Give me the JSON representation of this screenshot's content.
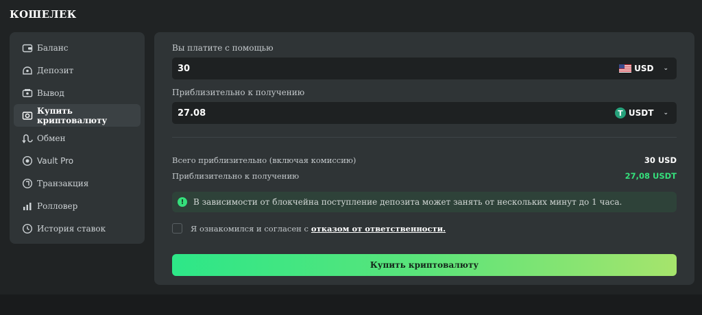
{
  "page": {
    "title": "КОШЕЛЕК"
  },
  "sidebar": {
    "items": [
      {
        "label": "Баланс",
        "icon": "wallet-icon"
      },
      {
        "label": "Депозит",
        "icon": "deposit-icon"
      },
      {
        "label": "Вывод",
        "icon": "withdraw-icon"
      },
      {
        "label": "Купить криптовалюту",
        "icon": "buy-crypto-icon",
        "active": true
      },
      {
        "label": "Обмен",
        "icon": "exchange-icon"
      },
      {
        "label": "Vault Pro",
        "icon": "vault-icon"
      },
      {
        "label": "Транзакция",
        "icon": "transaction-icon"
      },
      {
        "label": "Ролловер",
        "icon": "rollover-icon"
      },
      {
        "label": "История ставок",
        "icon": "clock-icon"
      }
    ]
  },
  "form": {
    "pay_label": "Вы платите с помощью",
    "pay_value": "30",
    "pay_currency": "USD",
    "receive_label": "Приблизительно к получению",
    "receive_value": "27.08",
    "receive_currency": "USDT"
  },
  "summary": {
    "total_label": "Всего приблизительно (включая комиссию)",
    "total_value": "30 USD",
    "receive_label": "Приблизительно к получению",
    "receive_value": "27,08 USDT"
  },
  "notice": {
    "text": "В зависимости от блокчейна поступление депозита может занять от нескольких минут до 1 часа."
  },
  "agreement": {
    "text": "Я ознакомился и согласен с",
    "link": "отказом от ответственности."
  },
  "buy_button": {
    "label": "Купить криптовалюту"
  },
  "colors": {
    "accent_green": "#35e07c",
    "button_gradient_start": "#2de788",
    "button_gradient_end": "#a6e46c",
    "panel_bg": "#2f3436",
    "input_bg": "#1e2122"
  }
}
